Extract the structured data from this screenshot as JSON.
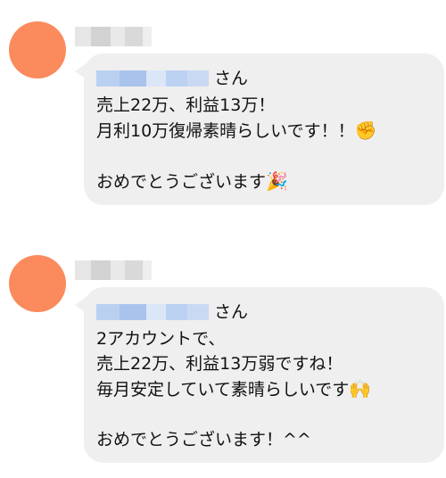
{
  "messages": [
    {
      "suffix": "さん",
      "lines": [
        "売上22万、利益13万！",
        "月利10万復帰素晴らしいです！！",
        "",
        "おめでとうございます"
      ],
      "emojis": {
        "line2": "✊",
        "line4": "🎉"
      }
    },
    {
      "suffix": "さん",
      "lines": [
        "2アカウントで、",
        "売上22万、利益13万弱ですね！",
        "毎月安定していて素晴らしいです",
        "",
        "おめでとうございます！^^"
      ],
      "emojis": {
        "line3": "🙌"
      }
    }
  ],
  "colors": {
    "avatar": "#fb8a5c",
    "bubble": "#efefef",
    "mention_blur": "#b7cdee",
    "name_blur": "#d8d8d8"
  }
}
